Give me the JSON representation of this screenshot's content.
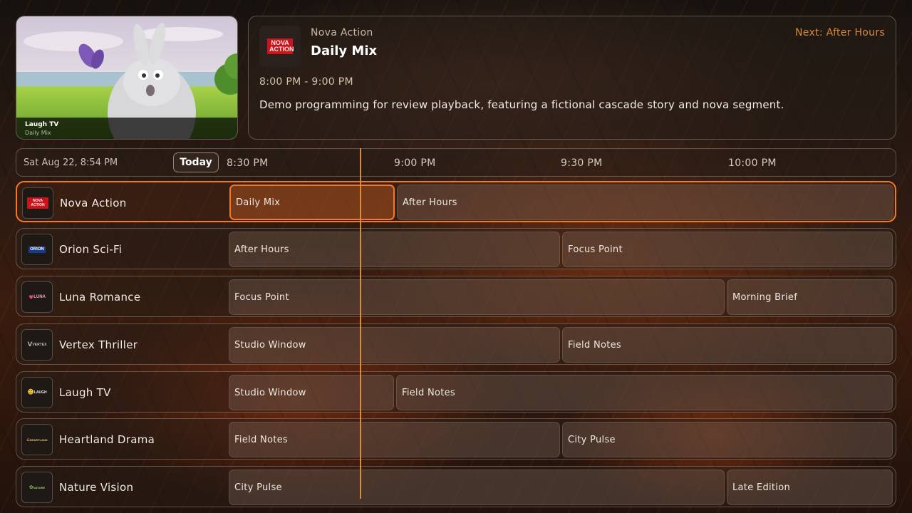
{
  "preview": {
    "channel": "Laugh TV",
    "program": "Daily Mix"
  },
  "info": {
    "logo_text": "NOVA ACTION",
    "channel": "Nova Action",
    "title": "Daily Mix",
    "next": "Next: After Hours",
    "time": "8:00 PM - 9:00 PM",
    "description": "Demo programming for review playback, featuring a fictional cascade story and nova segment."
  },
  "timebar": {
    "date": "Sat Aug 22, 8:54 PM",
    "today": "Today",
    "slots": [
      "8:30 PM",
      "9:00 PM",
      "9:30 PM",
      "10:00 PM"
    ]
  },
  "channels": [
    {
      "name": "Nova Action",
      "logo": "NOVA ACTION",
      "programs": [
        "Daily Mix",
        "After Hours"
      ]
    },
    {
      "name": "Orion Sci-Fi",
      "logo": "ORION",
      "programs": [
        "After Hours",
        "Focus Point"
      ]
    },
    {
      "name": "Luna Romance",
      "logo": "LUNA",
      "programs": [
        "Focus Point",
        "Morning Brief"
      ]
    },
    {
      "name": "Vertex Thriller",
      "logo": "VERTEX",
      "programs": [
        "Studio Window",
        "Field Notes"
      ]
    },
    {
      "name": "Laugh TV",
      "logo": "LAUGH",
      "programs": [
        "Studio Window",
        "Field Notes"
      ]
    },
    {
      "name": "Heartland Drama",
      "logo": "HEARTLAND",
      "programs": [
        "Field Notes",
        "City Pulse"
      ]
    },
    {
      "name": "Nature Vision",
      "logo": "NATURE",
      "programs": [
        "City Pulse",
        "Late Edition"
      ]
    }
  ],
  "colors": {
    "accent": "#f07a25",
    "now_line": "#e58f3c",
    "next_text": "#d8893a"
  }
}
